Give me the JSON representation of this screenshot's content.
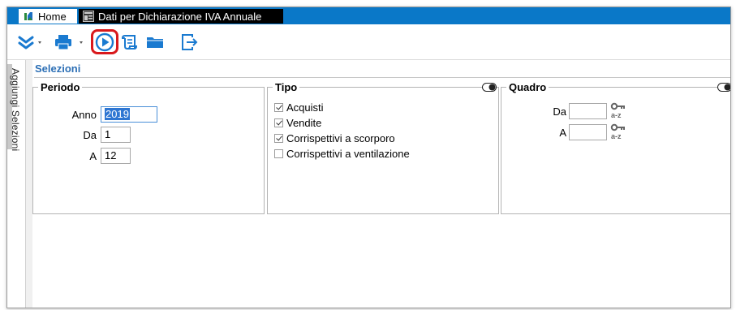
{
  "tabs": [
    {
      "label": "Home",
      "icon": "home-app-icon"
    },
    {
      "label": "Dati per Dichiarazione IVA Annuale",
      "icon": "form-window-icon"
    }
  ],
  "toolbar": {
    "buttons": [
      {
        "name": "expand-menu",
        "icon": "double-chevron-down-icon",
        "has_dropdown": true
      },
      {
        "name": "print",
        "icon": "printer-icon",
        "has_dropdown": true
      },
      {
        "name": "run",
        "icon": "play-circle-icon",
        "highlighted": true
      },
      {
        "name": "report",
        "icon": "scroll-document-icon"
      },
      {
        "name": "open-folder",
        "icon": "folder-icon"
      },
      {
        "name": "exit",
        "icon": "exit-icon"
      }
    ],
    "accent_color": "#1a7ad0",
    "highlight_color": "#d9191c"
  },
  "sidebar": {
    "label": "Aggiungi Selezioni"
  },
  "selections": {
    "title": "Selezioni",
    "periodo": {
      "title": "Periodo",
      "anno_label": "Anno",
      "anno_value": "2019",
      "da_label": "Da",
      "da_value": "1",
      "a_label": "A",
      "a_value": "12"
    },
    "tipo": {
      "title": "Tipo",
      "options": [
        {
          "label": "Acquisti",
          "checked": true
        },
        {
          "label": "Vendite",
          "checked": true
        },
        {
          "label": "Corrispettivi a scorporo",
          "checked": true
        },
        {
          "label": "Corrispettivi a ventilazione",
          "checked": false
        }
      ]
    },
    "quadro": {
      "title": "Quadro",
      "da_label": "Da",
      "da_value": "",
      "a_label": "A",
      "a_value": "",
      "lookup_icon": "key-az-icon"
    }
  },
  "colors": {
    "tabbar": "#0a78c8",
    "section_title": "#2c6fb5"
  }
}
